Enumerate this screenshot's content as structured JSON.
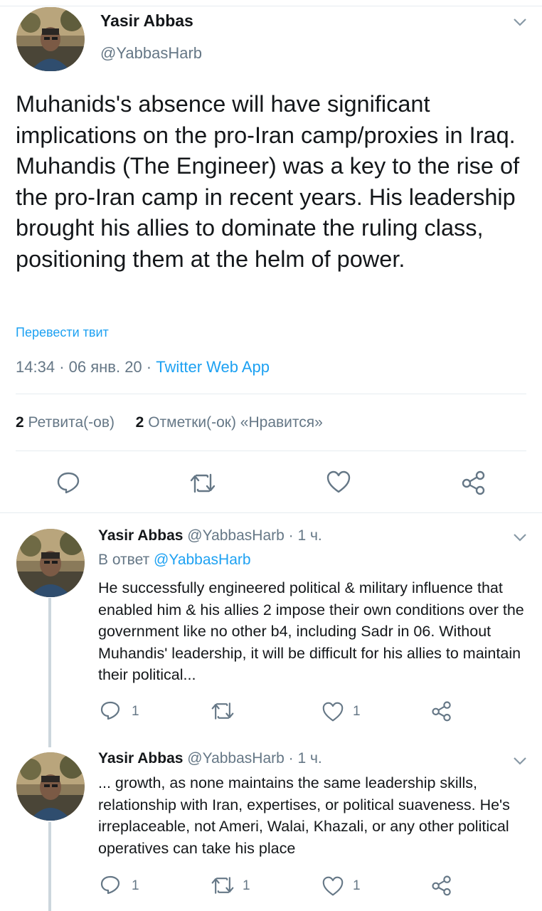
{
  "main_tweet": {
    "author_name": "Yasir Abbas",
    "handle": "@YabbasHarb",
    "text": "Muhanids's absence will have significant implications on the pro-Iran camp/proxies in Iraq. Muhandis (The Engineer) was a key to the rise of the pro-Iran camp in recent years. His leadership brought his allies to dominate the ruling class, positioning them at the helm of power.",
    "translate_label": "Перевести твит",
    "time": "14:34",
    "date": "06 янв. 20",
    "separator": "·",
    "source": "Twitter Web App",
    "retweets_count": "2",
    "retweets_label": "Ретвита(-ов)",
    "likes_count": "2",
    "likes_label": "Отметки(-ок) «Нравится»"
  },
  "replies": [
    {
      "author_name": "Yasir Abbas",
      "handle": "@YabbasHarb",
      "time": "· 1 ч.",
      "reply_to_label": "В ответ",
      "reply_to_handle": "@YabbasHarb",
      "text": "He successfully engineered political & military influence that enabled him & his allies 2 impose their own conditions over the government like no other b4, including Sadr in 06. Without Muhandis' leadership, it will be difficult for his allies to maintain their political...",
      "reply_count": "1",
      "retweet_count": "",
      "like_count": "1"
    },
    {
      "author_name": "Yasir Abbas",
      "handle": "@YabbasHarb",
      "time": "· 1 ч.",
      "text": "... growth, as none maintains the same leadership skills, relationship with Iran, expertises, or political suaveness. He's irreplaceable, not Ameri, Walai, Khazali, or any other political operatives can take his place",
      "reply_count": "1",
      "retweet_count": "1",
      "like_count": "1"
    }
  ],
  "colors": {
    "accent": "#1da1f2",
    "secondary_text": "#657786",
    "primary_text": "#14171a",
    "divider": "#e6ecf0"
  },
  "icons": [
    "chevron-down-icon",
    "reply-icon",
    "retweet-icon",
    "like-icon",
    "share-icon"
  ]
}
